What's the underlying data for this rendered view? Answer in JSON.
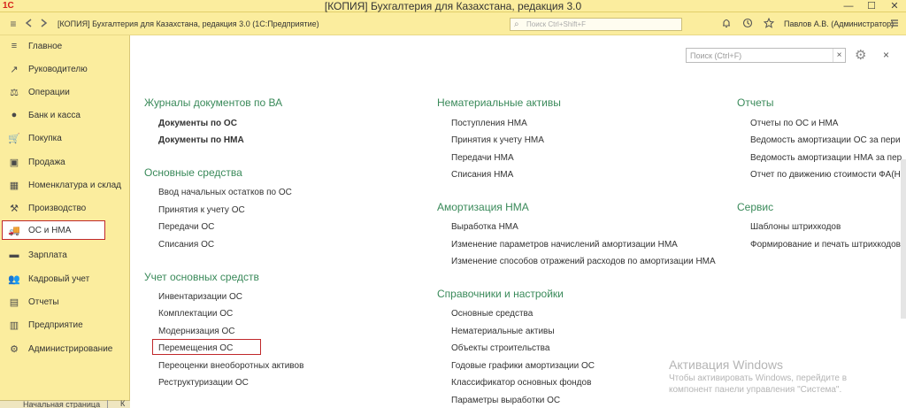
{
  "titlebar": {
    "logo": "1С",
    "title": "[КОПИЯ] Бухгалтерия для Казахстана, редакция 3.0",
    "minimize": "—",
    "maximize": "☐",
    "close": "✕"
  },
  "header": {
    "app_title": "[КОПИЯ] Бухгалтерия для Казахстана, редакция 3.0 (1С:Предприятие)",
    "search_placeholder": "Поиск Ctrl+Shift+F",
    "user": "Павлов А.В. (Администратор)",
    "menu_glyph": "≡"
  },
  "sidebar": {
    "items": [
      {
        "label": "Главное",
        "icon": "≡"
      },
      {
        "label": "Руководителю",
        "icon": "↗"
      },
      {
        "label": "Операции",
        "icon": "⚖"
      },
      {
        "label": "Банк и касса",
        "icon": "●"
      },
      {
        "label": "Покупка",
        "icon": "🛒"
      },
      {
        "label": "Продажа",
        "icon": "▣"
      },
      {
        "label": "Номенклатура и склад",
        "icon": "▦"
      },
      {
        "label": "Производство",
        "icon": "⚒"
      },
      {
        "label": "ОС и НМА",
        "icon": "🚚"
      },
      {
        "label": "Зарплата",
        "icon": "▬"
      },
      {
        "label": "Кадровый учет",
        "icon": "👥"
      },
      {
        "label": "Отчеты",
        "icon": "▤"
      },
      {
        "label": "Предприятие",
        "icon": "▥"
      },
      {
        "label": "Администрирование",
        "icon": "⚙"
      }
    ],
    "bottom_tab": "Начальная страница",
    "second_tab": "К"
  },
  "panel": {
    "search_placeholder": "Поиск (Ctrl+F)",
    "clear": "×",
    "gear": "⚙",
    "close": "×"
  },
  "col1": {
    "sec1": "Журналы документов по ВА",
    "sec1_items": [
      "Документы по ОС",
      "Документы по НМА"
    ],
    "sec2": "Основные средства",
    "sec2_items": [
      "Ввод начальных остатков по ОС",
      "Принятия к учету ОС",
      "Передачи ОС",
      "Списания ОС"
    ],
    "sec3": "Учет основных средств",
    "sec3_items": [
      "Инвентаризации ОС",
      "Комплектации ОС",
      "Модернизация ОС",
      "Перемещения ОС",
      "Переоценки внеоборотных активов",
      "Реструктуризации ОС"
    ]
  },
  "col2": {
    "sec1": "Нематериальные активы",
    "sec1_items": [
      "Поступления НМА",
      "Принятия к учету НМА",
      "Передачи НМА",
      "Списания НМА"
    ],
    "sec2": "Амортизация НМА",
    "sec2_items": [
      "Выработка НМА",
      "Изменение параметров начислений амортизации НМА",
      "Изменение способов отражений расходов по амортизации НМА"
    ],
    "sec3": "Справочники и настройки",
    "sec3_items": [
      "Основные средства",
      "Нематериальные активы",
      "Объекты строительства",
      "Годовые графики амортизации ОС",
      "Классификатор основных фондов",
      "Параметры выработки ОС"
    ]
  },
  "col3": {
    "sec1": "Отчеты",
    "sec1_items": [
      "Отчеты по ОС и НМА",
      "Ведомость амортизации ОС за пери",
      "Ведомость амортизации НМА за пер",
      "Отчет по движению стоимости ФА(Н"
    ],
    "sec2": "Сервис",
    "sec2_items": [
      "Шаблоны штрихкодов",
      "Формирование и печать штрихкодов"
    ]
  },
  "watermark": {
    "title": "Активация Windows",
    "line1": "Чтобы активировать Windows, перейдите в",
    "line2": "компонент панели управления \"Система\"."
  }
}
